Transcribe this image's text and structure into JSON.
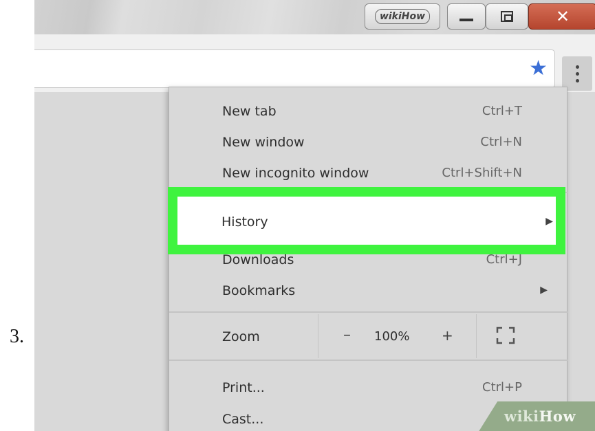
{
  "step_label": "3.",
  "titlebar": {
    "brand": "wikiHow"
  },
  "menu": {
    "items": [
      {
        "label": "New tab",
        "shortcut": "Ctrl+T"
      },
      {
        "label": "New window",
        "shortcut": "Ctrl+N"
      },
      {
        "label": "New incognito window",
        "shortcut": "Ctrl+Shift+N"
      },
      {
        "label": "Downloads",
        "shortcut": "Ctrl+J"
      },
      {
        "label": "Bookmarks",
        "arrow": "▶"
      }
    ],
    "highlighted": {
      "label": "History",
      "arrow": "▶"
    },
    "zoom": {
      "label": "Zoom",
      "minus": "–",
      "value": "100%",
      "plus": "+"
    },
    "bottom_items": [
      {
        "label": "Print...",
        "shortcut": "Ctrl+P"
      },
      {
        "label": "Cast..."
      }
    ]
  },
  "watermark": {
    "part1": "wiki",
    "part2": "How"
  },
  "icons": {
    "star": "bookmark-star-icon",
    "menu": "three-dot-menu-icon",
    "fullscreen": "fullscreen-icon"
  },
  "colors": {
    "highlight": "#3ff33f",
    "star": "#3b6fd6",
    "close_button": "#c4533c"
  }
}
